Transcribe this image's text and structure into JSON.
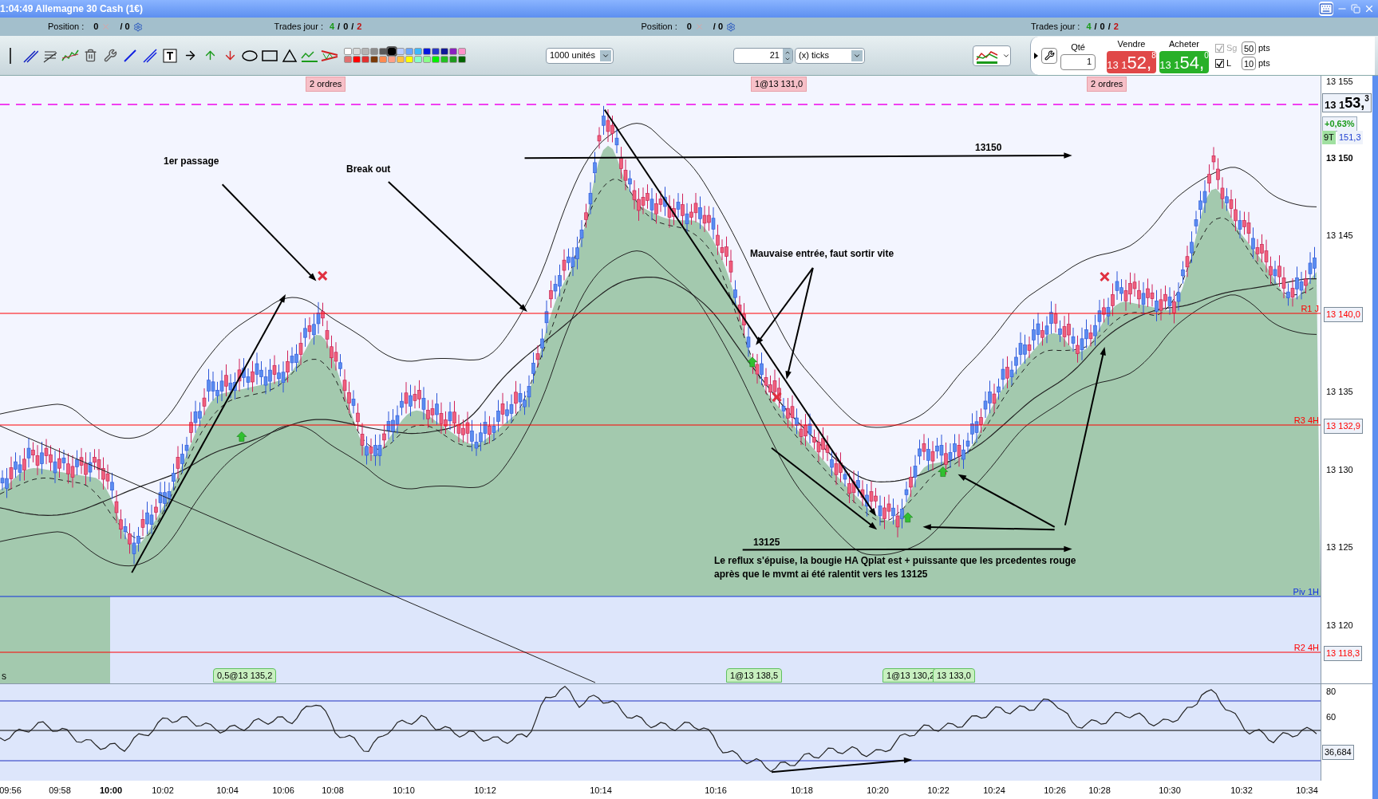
{
  "window": {
    "title": "1:04:49 Allemagne 30 Cash (1€)"
  },
  "info_bar": [
    {
      "kind": "position",
      "label": "Position :",
      "value": "0",
      "total": "/ 0"
    },
    {
      "kind": "trades",
      "label": "Trades jour :",
      "won": "4",
      "sep1": "/",
      "even": "0",
      "sep2": "/",
      "lost": "2"
    },
    {
      "kind": "position",
      "label": "Position :",
      "value": "0",
      "total": "/ 0"
    },
    {
      "kind": "trades",
      "label": "Trades jour :",
      "won": "4",
      "sep1": "/",
      "even": "0",
      "sep2": "/",
      "lost": "2"
    }
  ],
  "toolbar": {
    "palette": [
      {
        "color": "#ffffff",
        "selected": false
      },
      {
        "color": "#d8d8d8",
        "selected": false
      },
      {
        "color": "#b4b4b4",
        "selected": false
      },
      {
        "color": "#8c8c8c",
        "selected": false
      },
      {
        "color": "#5a5a5a",
        "selected": false
      },
      {
        "color": "#000000",
        "selected": true
      },
      {
        "color": "#b8ccff",
        "selected": false
      },
      {
        "color": "#6aa6ff",
        "selected": false
      },
      {
        "color": "#3cb8ff",
        "selected": false
      },
      {
        "color": "#0018e0",
        "selected": false
      },
      {
        "color": "#2838c8",
        "selected": false
      },
      {
        "color": "#101898",
        "selected": false
      },
      {
        "color": "#8a20c0",
        "selected": false
      },
      {
        "color": "#ff90c8",
        "selected": false
      },
      {
        "color": "#e07070",
        "selected": false
      },
      {
        "color": "#ff0000",
        "selected": false
      },
      {
        "color": "#e03030",
        "selected": false
      },
      {
        "color": "#7a3a08",
        "selected": false
      },
      {
        "color": "#ff8a50",
        "selected": false
      },
      {
        "color": "#ffa088",
        "selected": false
      },
      {
        "color": "#ffc040",
        "selected": false
      },
      {
        "color": "#ffff00",
        "selected": false
      },
      {
        "color": "#88ffc8",
        "selected": false
      },
      {
        "color": "#88ff88",
        "selected": false
      },
      {
        "color": "#00f000",
        "selected": false
      },
      {
        "color": "#22c022",
        "selected": false
      },
      {
        "color": "#1e9a1e",
        "selected": false
      },
      {
        "color": "#006400",
        "selected": false
      }
    ],
    "units": "1000 unités",
    "period": "21",
    "period_unit": "(x) ticks"
  },
  "trade_panel": {
    "qty_label": "Qté",
    "qty": "1",
    "sell_label": "Vendre",
    "sell": {
      "small": "13 1",
      "big": "52,",
      "sup": "8"
    },
    "buy_label": "Acheter",
    "buy": {
      "small": "13 1",
      "big": "54,",
      "sup": "0"
    },
    "options": [
      {
        "label": "Sg",
        "checked": true,
        "disabled": true,
        "value": "50",
        "unit": "pts"
      },
      {
        "label": "L",
        "checked": true,
        "disabled": false,
        "value": "10",
        "unit": "pts"
      }
    ]
  },
  "chart": {
    "top_tags": [
      "2 ordres",
      "1@13 131,0",
      "2 ordres"
    ],
    "bottom_tags": [
      "0,5@13 135,2",
      "1@13 138,5",
      "1@13 130,2",
      "13 133,0"
    ],
    "annotations": [
      "1er passage",
      "Break out",
      "13150",
      "Mauvaise entrée, faut sortir vite",
      "13125",
      "Le reflux s'épuise, la bougie HA Qplat est + puissante que les prcedentes rouge",
      "après que le mvmt ai été ralentit vers les 13125",
      "s"
    ],
    "level_lines": [
      {
        "name": "R1 J",
        "value": "13 140,0",
        "color": "#ff0000"
      },
      {
        "name": "R3 4H",
        "value": "13 132,9",
        "color": "#ff0000"
      },
      {
        "name": "Piv 1H",
        "color": "#1030e0"
      },
      {
        "name": "R2 4H",
        "value": "13 118,3",
        "color": "#ff0000"
      }
    ],
    "price_ticks": [
      "13 155",
      "13 150",
      "13 145",
      "13 135",
      "13 130",
      "13 125",
      "13 120"
    ],
    "last_price": {
      "small": "13 1",
      "big": "53,",
      "sup": "3"
    },
    "change": "+0,63%",
    "tick_tag": "9T",
    "tick_value": "151,3"
  },
  "rsi": {
    "ticks": [
      "80",
      "60"
    ],
    "value": "36,684"
  },
  "time_axis": [
    {
      "label": "09:56",
      "bold": false
    },
    {
      "label": "09:58",
      "bold": false
    },
    {
      "label": "10:00",
      "bold": true
    },
    {
      "label": "10:02",
      "bold": false
    },
    {
      "label": "10:04",
      "bold": false
    },
    {
      "label": "10:06",
      "bold": false
    },
    {
      "label": "10:08",
      "bold": false
    },
    {
      "label": "10:10",
      "bold": false
    },
    {
      "label": "10:12",
      "bold": false
    },
    {
      "label": "10:14",
      "bold": false
    },
    {
      "label": "10:16",
      "bold": false
    },
    {
      "label": "10:18",
      "bold": false
    },
    {
      "label": "10:20",
      "bold": false
    },
    {
      "label": "10:22",
      "bold": false
    },
    {
      "label": "10:24",
      "bold": false
    },
    {
      "label": "10:26",
      "bold": false
    },
    {
      "label": "10:28",
      "bold": false
    },
    {
      "label": "10:30",
      "bold": false
    },
    {
      "label": "10:32",
      "bold": false
    },
    {
      "label": "10:34",
      "bold": false
    }
  ]
}
